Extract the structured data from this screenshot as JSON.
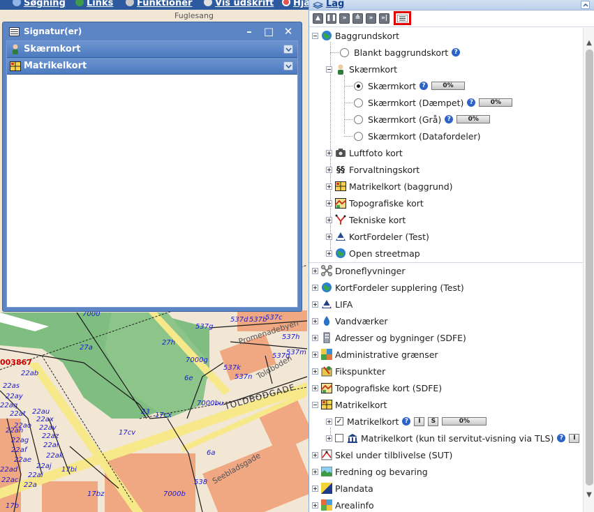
{
  "toolbar": {
    "items": [
      {
        "label": "Søgning",
        "icon": "magnifier-icon"
      },
      {
        "label": "Links",
        "icon": "globe-icon"
      },
      {
        "label": "Funktioner",
        "icon": "gears-icon"
      },
      {
        "label": "Vis udskrift",
        "icon": "print-icon"
      },
      {
        "label": "Hja",
        "icon": "lifebuoy-icon"
      }
    ]
  },
  "signature_window": {
    "title": "Signatur(er)",
    "sections": [
      {
        "label": "Skærmkort",
        "icon": "person-icon"
      },
      {
        "label": "Matrikelkort",
        "icon": "matrikel-icon"
      }
    ]
  },
  "layers_panel": {
    "title": "Lag",
    "tools": [
      "collapse-all",
      "pause",
      "fast-forward",
      "expand",
      "skip",
      "skip-end",
      "legend"
    ],
    "tree": {
      "baggrundskort": {
        "label": "Baggrundskort",
        "blank": "Blankt baggrundskort",
        "skaermkort_group": "Skærmkort",
        "skaermkort_options": [
          {
            "label": "Skærmkort",
            "selected": true,
            "pct": "0%"
          },
          {
            "label": "Skærmkort (Dæmpet)",
            "selected": false,
            "pct": "0%"
          },
          {
            "label": "Skærmkort (Grå)",
            "selected": false,
            "pct": "0%"
          },
          {
            "label": "Skærmkort (Datafordeler)",
            "selected": false
          }
        ],
        "children": [
          {
            "label": "Luftfoto kort",
            "icon": "camera-icon"
          },
          {
            "label": "Forvaltningskort",
            "icon": "paragraph-icon"
          },
          {
            "label": "Matrikelkort (baggrund)",
            "icon": "matrikel-icon"
          },
          {
            "label": "Topografiske kort",
            "icon": "topo-icon"
          },
          {
            "label": "Tekniske kort",
            "icon": "technical-icon"
          },
          {
            "label": "KortFordeler (Test)",
            "icon": "kortfordeler-icon"
          },
          {
            "label": "Open streetmap",
            "icon": "globe-icon"
          }
        ]
      },
      "top_level": [
        {
          "label": "Droneflyvninger",
          "icon": "drone-icon"
        },
        {
          "label": "KortFordeler supplering (Test)",
          "icon": "globe-icon"
        },
        {
          "label": "LIFA",
          "icon": "lifa-icon"
        },
        {
          "label": "Vandværker",
          "icon": "drop-icon"
        },
        {
          "label": "Adresser og bygninger (SDFE)",
          "icon": "building-icon"
        },
        {
          "label": "Administrative grænser",
          "icon": "borders-icon"
        },
        {
          "label": "Fikspunkter",
          "icon": "fixpoint-icon"
        },
        {
          "label": "Topografiske kort (SDFE)",
          "icon": "topo-icon"
        }
      ],
      "matrikelkort": {
        "label": "Matrikelkort",
        "layer1": {
          "label": "Matrikelkort",
          "checked": true,
          "btn_i": "I",
          "btn_s": "S",
          "pct": "0%"
        },
        "layer2": {
          "label": "Matrikelkort (kun til servitut-visning via TLS)",
          "checked": false,
          "btn_i": "I"
        }
      },
      "bottom": [
        {
          "label": "Skel under tilblivelse (SUT)",
          "icon": "skel-icon"
        },
        {
          "label": "Fredning og bevaring",
          "icon": "landscape-icon"
        },
        {
          "label": "Plandata",
          "icon": "plandata-icon"
        },
        {
          "label": "Arealinfo",
          "icon": "arealinfo-icon"
        }
      ]
    }
  },
  "map": {
    "labels": {
      "fuglesang": "Fuglesang",
      "toldbodgade": "TOLDBODGADE",
      "seebladsgade": "Seebladsgade",
      "toldboden": "Toldboden",
      "promenade": "Promenadebyen",
      "parcel_id": "003867",
      "l537g": "537g",
      "l537d": "537d",
      "l537b": "537b",
      "l537c": "537c",
      "l537h": "537h",
      "l537k": "537k",
      "l537n": "537n",
      "l537q": "537q",
      "l537m": "537m",
      "l7000": "7000",
      "l7000g": "7000g",
      "l7000bu": "7000bu",
      "l7000b": "7000b",
      "l27h": "27h",
      "l27a": "27a",
      "l6e": "6e",
      "l6a": "6a",
      "l23": "23",
      "l17cx": "17cx",
      "l17cv": "17cv",
      "l17bz": "17bz",
      "l17bi": "17bi",
      "l17b": "17b",
      "l22ab": "22ab",
      "l22as": "22as",
      "l22au": "22au",
      "l22ay": "22ay",
      "l22ax": "22ax",
      "l22aq": "22aq",
      "l22av": "22av",
      "l22at": "22at",
      "l22az": "22az",
      "l22ah": "22ah",
      "l22af": "22af",
      "l22ag": "22ag",
      "l22ae": "22ae",
      "l22al": "22al",
      "l22ak": "22ak",
      "l22aj": "22aj",
      "l22ai": "22ai",
      "l22ao": "22ao",
      "l22ad": "22ad",
      "l22ac": "22ac",
      "l22a": "22a",
      "l538": "538"
    }
  }
}
